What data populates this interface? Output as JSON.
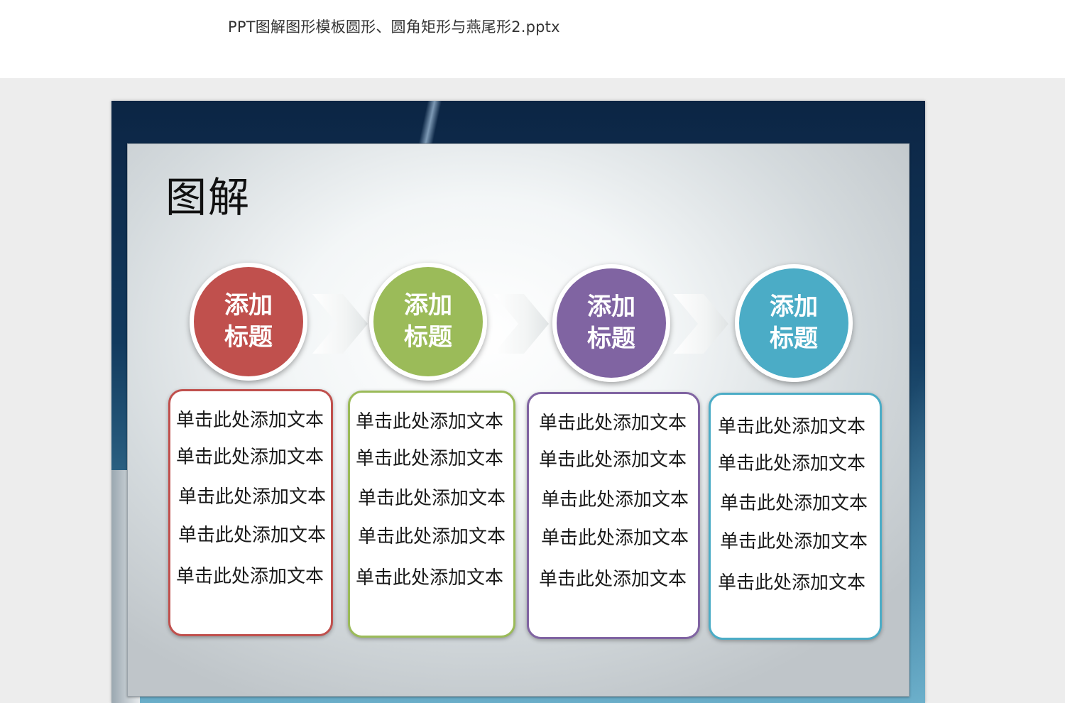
{
  "window": {
    "file_title": "PPT图解图形模板圆形、圆角矩形与燕尾形2.pptx"
  },
  "slide": {
    "title": "图解",
    "steps": [
      {
        "title_line1": "添加",
        "title_line2": "标题",
        "color": "#c0504d",
        "lines": [
          "单击此处添加文本",
          "单击此处添加文本",
          "单击此处添加文本",
          "单击此处添加文本",
          "单击此处添加文本"
        ]
      },
      {
        "title_line1": "添加",
        "title_line2": "标题",
        "color": "#9bbb59",
        "lines": [
          "单击此处添加文本",
          "单击此处添加文本",
          "单击此处添加文本",
          "单击此处添加文本",
          "单击此处添加文本"
        ]
      },
      {
        "title_line1": "添加",
        "title_line2": "标题",
        "color": "#8064a2",
        "lines": [
          "单击此处添加文本",
          "单击此处添加文本",
          "单击此处添加文本",
          "单击此处添加文本",
          "单击此处添加文本"
        ]
      },
      {
        "title_line1": "添加",
        "title_line2": "标题",
        "color": "#4bacc6",
        "lines": [
          "单击此处添加文本",
          "单击此处添加文本",
          "单击此处添加文本",
          "单击此处添加文本",
          "单击此处添加文本"
        ]
      }
    ]
  }
}
